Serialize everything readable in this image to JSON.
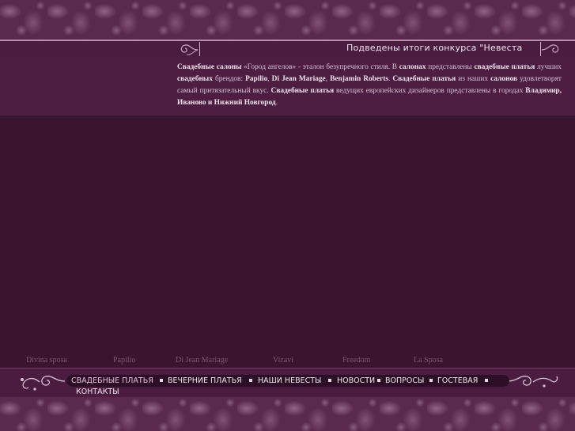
{
  "header": {
    "marquee": "Подведены итоги конкурса \"Невеста"
  },
  "intro": {
    "p1": "Свадебные салоны",
    "p2": " «Город ангелов» - эталон безупречного стиля. В ",
    "p3": "салонах",
    "p4": " представлены ",
    "p5": "свадебные платья",
    "p6": " лучших ",
    "p7": "свадебных",
    "p8": " брендов: ",
    "p9": "Papilio",
    "p10": ", ",
    "p11": "Di Jean Mariage",
    "p12": ", ",
    "p13": "Benjamin Roberts",
    "p14": ". ",
    "p15": "Свадебные платья",
    "p16": " из наших ",
    "p17": "салонов",
    "p18": " удовлетворят самый притязательный вкус. ",
    "p19": "Свадебные платья",
    "p20": " ведущих европейских дизайнеров представлены в городах ",
    "p21": "Владимир, Иваново и Нижний Новгород",
    "p22": "."
  },
  "brands": [
    "Divina sposa",
    "Papilio",
    "Di Jean Mariage",
    "Vizavi",
    "Freedom",
    "La Sposa"
  ],
  "nav": {
    "items": [
      "СВАДЕБНЫЕ ПЛАТЬЯ",
      "ВЕЧЕРНИЕ ПЛАТЬЯ",
      "НАШИ НЕВЕСТЫ",
      "НОВОСТИ",
      "ВОПРОСЫ",
      "ГОСТЕВАЯ",
      "КОНТАКТЫ"
    ]
  },
  "colors": {
    "background": "#3a1530",
    "panel": "#4d1e42",
    "accent": "#b690a8",
    "text": "#d8c3d3"
  }
}
